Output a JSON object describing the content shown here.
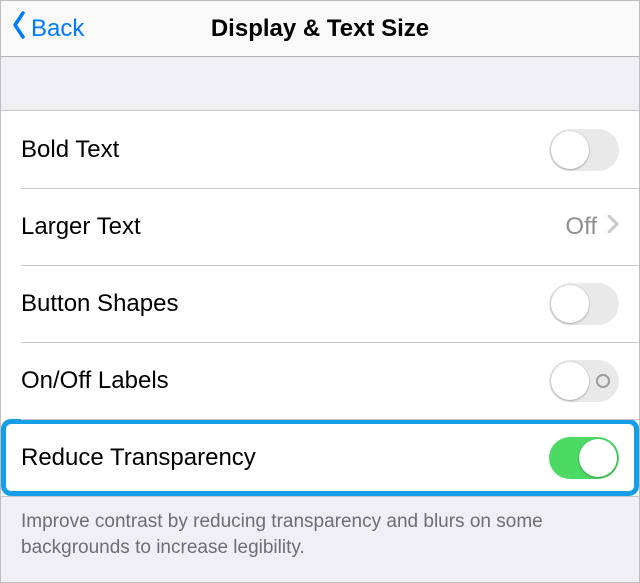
{
  "nav": {
    "back_label": "Back",
    "title": "Display & Text Size"
  },
  "rows": {
    "bold_text": {
      "label": "Bold Text",
      "on": false
    },
    "larger_text": {
      "label": "Larger Text",
      "value": "Off"
    },
    "button_shapes": {
      "label": "Button Shapes",
      "on": false
    },
    "onoff_labels": {
      "label": "On/Off Labels",
      "on": false,
      "show_indicator": true
    },
    "reduce_transparency": {
      "label": "Reduce Transparency",
      "on": true
    }
  },
  "footer": "Improve contrast by reducing transparency and blurs on some backgrounds to increase legibility."
}
